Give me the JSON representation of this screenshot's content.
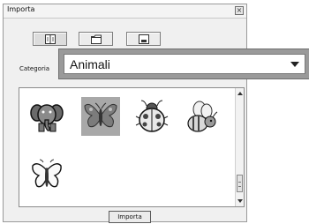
{
  "window": {
    "title": "Importa",
    "close_label": "×"
  },
  "toolbar": {
    "buttons": [
      {
        "name": "thumbnail-view",
        "icon": "grid-view-icon",
        "active": true
      },
      {
        "name": "folder",
        "icon": "folder-icon",
        "active": false
      },
      {
        "name": "disk",
        "icon": "disk-icon",
        "active": false
      }
    ]
  },
  "category": {
    "label": "Categoria",
    "selected": "Animali"
  },
  "thumbnails": [
    {
      "name": "elephant",
      "icon": "elephant-icon"
    },
    {
      "name": "butterfly-gray",
      "icon": "butterfly-icon",
      "selected": true
    },
    {
      "name": "ladybug",
      "icon": "ladybug-icon"
    },
    {
      "name": "bee",
      "icon": "bee-icon"
    },
    {
      "name": "butterfly-outline",
      "icon": "butterfly-outline-icon"
    }
  ],
  "footer": {
    "import_label": "Importa"
  },
  "colors": {
    "panel_bg": "#f0f0f0",
    "highlight_frame": "#9a9a9a",
    "selected_thumb_bg": "#a8a8a8"
  }
}
